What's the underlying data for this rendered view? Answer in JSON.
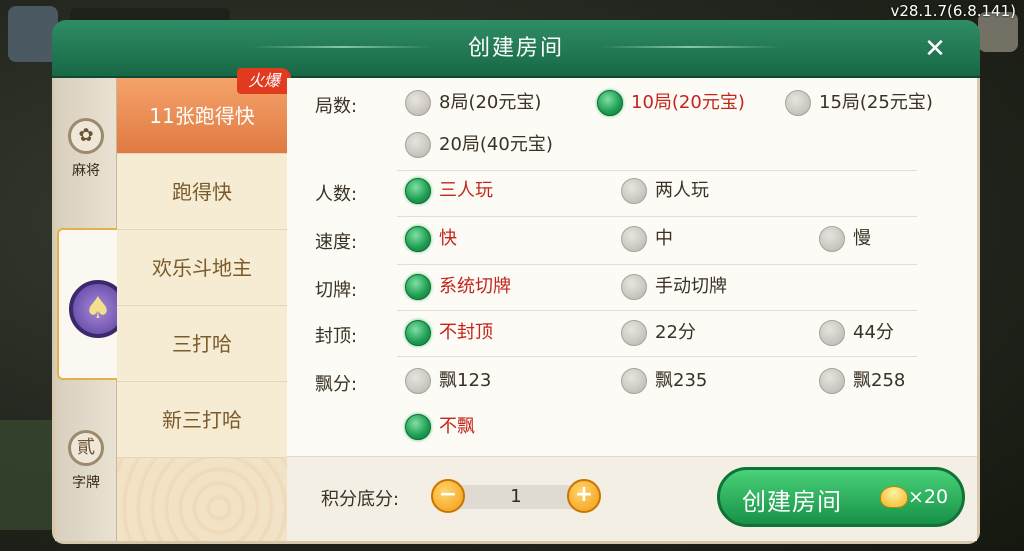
{
  "status": {
    "version": "v28.1.7(6.8.141)"
  },
  "dialog": {
    "title": "创建房间"
  },
  "categories": [
    {
      "label": "麻将",
      "icon": "mahjong-icon",
      "glyph": "✿"
    },
    {
      "label": "",
      "icon": "spade-icon",
      "glyph": "♠"
    },
    {
      "label": "字牌",
      "icon": "zipai-icon",
      "glyph": "貳"
    }
  ],
  "games": [
    {
      "label": "11张跑得快",
      "badge": "火爆",
      "active": true
    },
    {
      "label": "跑得快",
      "active": false
    },
    {
      "label": "欢乐斗地主",
      "active": false
    },
    {
      "label": "三打哈",
      "active": false
    },
    {
      "label": "新三打哈",
      "active": false
    }
  ],
  "options": {
    "rounds": {
      "label": "局数:",
      "choices": [
        "8局(20元宝)",
        "10局(20元宝)",
        "15局(25元宝)",
        "20局(40元宝)"
      ],
      "selected": 1
    },
    "players": {
      "label": "人数:",
      "choices": [
        "三人玩",
        "两人玩"
      ],
      "selected": 0
    },
    "speed": {
      "label": "速度:",
      "choices": [
        "快",
        "中",
        "慢"
      ],
      "selected": 0
    },
    "cut": {
      "label": "切牌:",
      "choices": [
        "系统切牌",
        "手动切牌"
      ],
      "selected": 0
    },
    "cap": {
      "label": "封顶:",
      "choices": [
        "不封顶",
        "22分",
        "44分"
      ],
      "selected": 0
    },
    "float": {
      "label": "飘分:",
      "choices": [
        "飘123",
        "飘235",
        "飘258",
        "不飘"
      ],
      "selected": 3
    }
  },
  "footer": {
    "score_label": "积分底分:",
    "score_value": "1",
    "minus": "−",
    "plus": "+",
    "create_label": "创建房间",
    "cost": "×20"
  },
  "colors": {
    "accent_green": "#1d9c52",
    "selected_text": "#c3251b",
    "title_bar": "#186845",
    "active_game": "#e07a42"
  }
}
